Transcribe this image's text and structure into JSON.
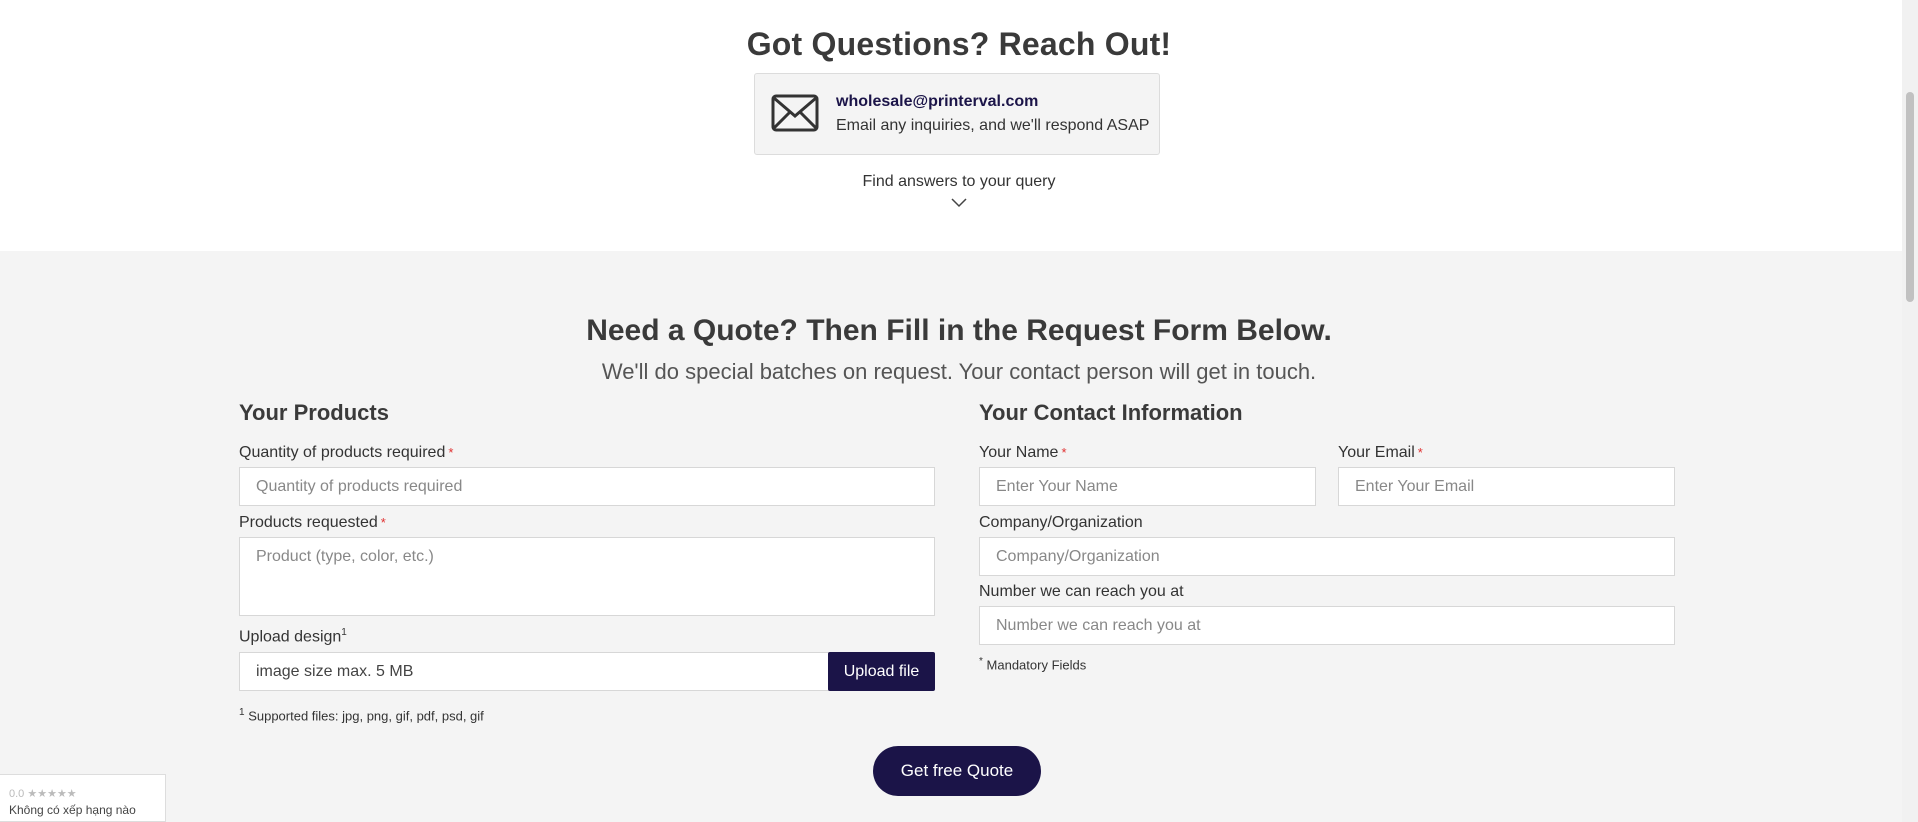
{
  "contact": {
    "title": "Got Questions? Reach Out!",
    "email": "wholesale@printerval.com",
    "description": "Email any inquiries, and we'll respond ASAP",
    "faq_link": "Find answers to your query"
  },
  "form": {
    "title": "Need a Quote? Then Fill in the Request Form Below.",
    "subtitle": "We'll do special batches on request. Your contact person will get in touch.",
    "products": {
      "heading": "Your Products",
      "quantity_label": "Quantity of products required",
      "quantity_placeholder": "Quantity of products required",
      "requested_label": "Products requested",
      "requested_placeholder": "Product (type, color, etc.)",
      "upload_label": "Upload design",
      "upload_sup": "1",
      "upload_placeholder": "image size max. 5 MB",
      "upload_button": "Upload file",
      "supported_sup": "1",
      "supported_note": "Supported files: jpg, png, gif, pdf, psd, gif"
    },
    "contact_info": {
      "heading": "Your Contact Information",
      "name_label": "Your Name",
      "name_placeholder": "Enter Your Name",
      "email_label": "Your Email",
      "email_placeholder": "Enter Your Email",
      "company_label": "Company/Organization",
      "company_placeholder": "Company/Organization",
      "phone_label": "Number we can reach you at",
      "phone_placeholder": "Number we can reach you at",
      "mandatory_mark": "*",
      "mandatory_note": "Mandatory Fields"
    },
    "required_mark": "*",
    "submit_label": "Get free Quote"
  },
  "rating_widget": {
    "score": "0.0",
    "stars": "★★★★★",
    "text": "Không có xếp hạng nào"
  },
  "colors": {
    "brand": "#1b1448",
    "required": "#e03030",
    "section_bg": "#f4f4f4"
  }
}
